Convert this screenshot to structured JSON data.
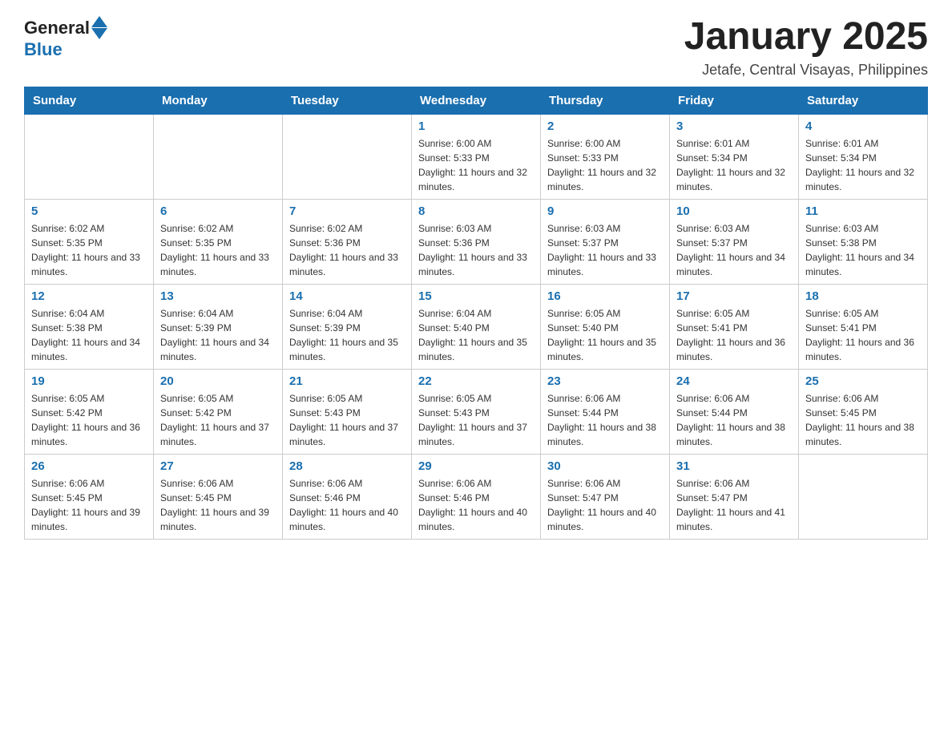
{
  "logo": {
    "general": "General",
    "blue": "Blue"
  },
  "header": {
    "title": "January 2025",
    "location": "Jetafe, Central Visayas, Philippines"
  },
  "weekdays": [
    "Sunday",
    "Monday",
    "Tuesday",
    "Wednesday",
    "Thursday",
    "Friday",
    "Saturday"
  ],
  "weeks": [
    [
      {
        "day": "",
        "info": ""
      },
      {
        "day": "",
        "info": ""
      },
      {
        "day": "",
        "info": ""
      },
      {
        "day": "1",
        "info": "Sunrise: 6:00 AM\nSunset: 5:33 PM\nDaylight: 11 hours and 32 minutes."
      },
      {
        "day": "2",
        "info": "Sunrise: 6:00 AM\nSunset: 5:33 PM\nDaylight: 11 hours and 32 minutes."
      },
      {
        "day": "3",
        "info": "Sunrise: 6:01 AM\nSunset: 5:34 PM\nDaylight: 11 hours and 32 minutes."
      },
      {
        "day": "4",
        "info": "Sunrise: 6:01 AM\nSunset: 5:34 PM\nDaylight: 11 hours and 32 minutes."
      }
    ],
    [
      {
        "day": "5",
        "info": "Sunrise: 6:02 AM\nSunset: 5:35 PM\nDaylight: 11 hours and 33 minutes."
      },
      {
        "day": "6",
        "info": "Sunrise: 6:02 AM\nSunset: 5:35 PM\nDaylight: 11 hours and 33 minutes."
      },
      {
        "day": "7",
        "info": "Sunrise: 6:02 AM\nSunset: 5:36 PM\nDaylight: 11 hours and 33 minutes."
      },
      {
        "day": "8",
        "info": "Sunrise: 6:03 AM\nSunset: 5:36 PM\nDaylight: 11 hours and 33 minutes."
      },
      {
        "day": "9",
        "info": "Sunrise: 6:03 AM\nSunset: 5:37 PM\nDaylight: 11 hours and 33 minutes."
      },
      {
        "day": "10",
        "info": "Sunrise: 6:03 AM\nSunset: 5:37 PM\nDaylight: 11 hours and 34 minutes."
      },
      {
        "day": "11",
        "info": "Sunrise: 6:03 AM\nSunset: 5:38 PM\nDaylight: 11 hours and 34 minutes."
      }
    ],
    [
      {
        "day": "12",
        "info": "Sunrise: 6:04 AM\nSunset: 5:38 PM\nDaylight: 11 hours and 34 minutes."
      },
      {
        "day": "13",
        "info": "Sunrise: 6:04 AM\nSunset: 5:39 PM\nDaylight: 11 hours and 34 minutes."
      },
      {
        "day": "14",
        "info": "Sunrise: 6:04 AM\nSunset: 5:39 PM\nDaylight: 11 hours and 35 minutes."
      },
      {
        "day": "15",
        "info": "Sunrise: 6:04 AM\nSunset: 5:40 PM\nDaylight: 11 hours and 35 minutes."
      },
      {
        "day": "16",
        "info": "Sunrise: 6:05 AM\nSunset: 5:40 PM\nDaylight: 11 hours and 35 minutes."
      },
      {
        "day": "17",
        "info": "Sunrise: 6:05 AM\nSunset: 5:41 PM\nDaylight: 11 hours and 36 minutes."
      },
      {
        "day": "18",
        "info": "Sunrise: 6:05 AM\nSunset: 5:41 PM\nDaylight: 11 hours and 36 minutes."
      }
    ],
    [
      {
        "day": "19",
        "info": "Sunrise: 6:05 AM\nSunset: 5:42 PM\nDaylight: 11 hours and 36 minutes."
      },
      {
        "day": "20",
        "info": "Sunrise: 6:05 AM\nSunset: 5:42 PM\nDaylight: 11 hours and 37 minutes."
      },
      {
        "day": "21",
        "info": "Sunrise: 6:05 AM\nSunset: 5:43 PM\nDaylight: 11 hours and 37 minutes."
      },
      {
        "day": "22",
        "info": "Sunrise: 6:05 AM\nSunset: 5:43 PM\nDaylight: 11 hours and 37 minutes."
      },
      {
        "day": "23",
        "info": "Sunrise: 6:06 AM\nSunset: 5:44 PM\nDaylight: 11 hours and 38 minutes."
      },
      {
        "day": "24",
        "info": "Sunrise: 6:06 AM\nSunset: 5:44 PM\nDaylight: 11 hours and 38 minutes."
      },
      {
        "day": "25",
        "info": "Sunrise: 6:06 AM\nSunset: 5:45 PM\nDaylight: 11 hours and 38 minutes."
      }
    ],
    [
      {
        "day": "26",
        "info": "Sunrise: 6:06 AM\nSunset: 5:45 PM\nDaylight: 11 hours and 39 minutes."
      },
      {
        "day": "27",
        "info": "Sunrise: 6:06 AM\nSunset: 5:45 PM\nDaylight: 11 hours and 39 minutes."
      },
      {
        "day": "28",
        "info": "Sunrise: 6:06 AM\nSunset: 5:46 PM\nDaylight: 11 hours and 40 minutes."
      },
      {
        "day": "29",
        "info": "Sunrise: 6:06 AM\nSunset: 5:46 PM\nDaylight: 11 hours and 40 minutes."
      },
      {
        "day": "30",
        "info": "Sunrise: 6:06 AM\nSunset: 5:47 PM\nDaylight: 11 hours and 40 minutes."
      },
      {
        "day": "31",
        "info": "Sunrise: 6:06 AM\nSunset: 5:47 PM\nDaylight: 11 hours and 41 minutes."
      },
      {
        "day": "",
        "info": ""
      }
    ]
  ]
}
